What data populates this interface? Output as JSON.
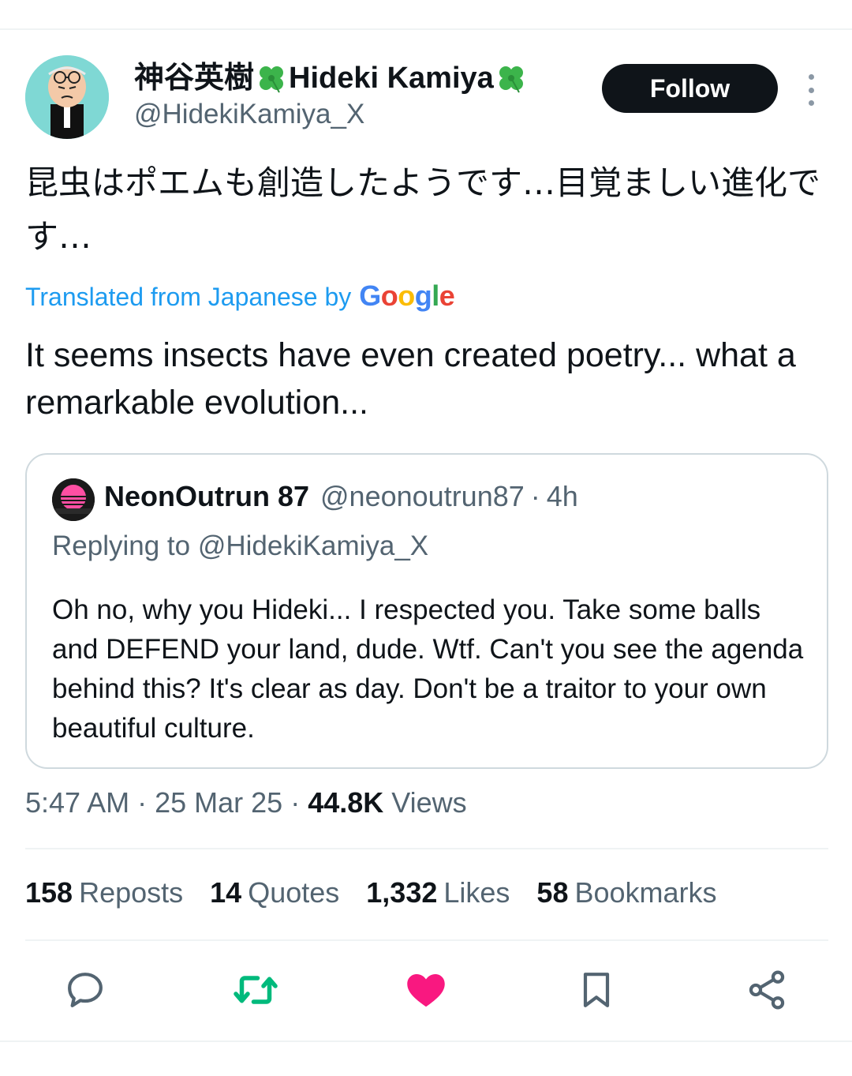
{
  "author": {
    "display_name_jp": "神谷英樹",
    "display_name_en": "Hideki Kamiya",
    "handle": "@HidekiKamiya_X",
    "avatar_icon": "cartoon-avatar-icon",
    "badge_icon": "four-leaf-clover-icon"
  },
  "follow_label": "Follow",
  "tweet": {
    "original_text": "昆虫はポエムも創造したようです…目覚ましい進化です…",
    "translated_prefix": "Translated from Japanese by",
    "translator": "Google",
    "translated_text": "It seems insects have even created poetry... what a remarkable evolution..."
  },
  "quote": {
    "display_name": "NeonOutrun 87",
    "handle": "@neonoutrun87",
    "separator": "·",
    "time": "4h",
    "replying_prefix": "Replying to",
    "replying_handle": "@HidekiKamiya_X",
    "body": "Oh no, why you Hideki... I respected you. Take some balls and DEFEND your land, dude. Wtf. Can't you see the agenda behind this? It's clear as day. Don't be a traitor to your own beautiful culture."
  },
  "meta": {
    "time": "5:47 AM",
    "sep1": " · ",
    "date": "25 Mar 25",
    "sep2": " · ",
    "views_count": "44.8K",
    "views_label": "Views"
  },
  "stats": [
    {
      "count": "158",
      "label": "Reposts"
    },
    {
      "count": "14",
      "label": "Quotes"
    },
    {
      "count": "1,332",
      "label": "Likes"
    },
    {
      "count": "58",
      "label": "Bookmarks"
    }
  ],
  "colors": {
    "link": "#1d9bf0",
    "secondary_text": "#536471",
    "retweet_green": "#00ba7c",
    "like_pink": "#f91880",
    "icon_gray": "#536471"
  }
}
